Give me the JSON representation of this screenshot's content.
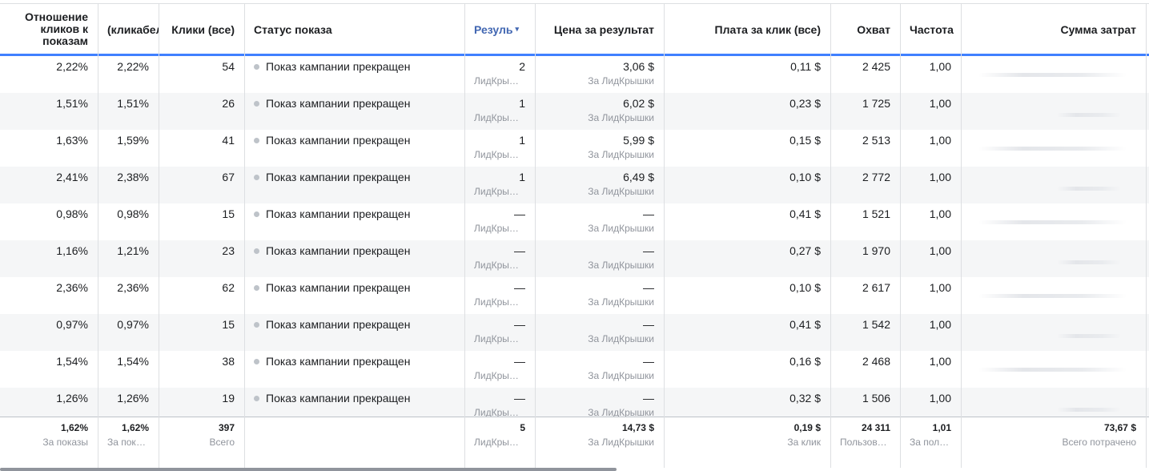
{
  "columns": {
    "ctr": "Отношение кликов к показам",
    "ctr_all": "(кликабельн",
    "clicks_all": "Клики (все)",
    "status": "Статус показа",
    "results": "Резуль",
    "cost_per_result": "Цена за результат",
    "cpc_all": "Плата за клик (все)",
    "reach": "Охват",
    "frequency": "Частота",
    "spend": "Сумма затрат"
  },
  "sort_indicator": "▾",
  "rows": [
    {
      "ctr": "2,22%",
      "ctr_all": "2,22%",
      "clicks": "54",
      "status": "Показ кампании прекращен",
      "results": "2",
      "results_sub": "ЛидКрышки",
      "cost": "3,06 $",
      "cost_sub": "За ЛидКрышки",
      "cpc": "0,11 $",
      "reach": "2 425",
      "freq": "1,00"
    },
    {
      "ctr": "1,51%",
      "ctr_all": "1,51%",
      "clicks": "26",
      "status": "Показ кампании прекращен",
      "results": "1",
      "results_sub": "ЛидКрышки",
      "cost": "6,02 $",
      "cost_sub": "За ЛидКрышки",
      "cpc": "0,23 $",
      "reach": "1 725",
      "freq": "1,00"
    },
    {
      "ctr": "1,63%",
      "ctr_all": "1,59%",
      "clicks": "41",
      "status": "Показ кампании прекращен",
      "results": "1",
      "results_sub": "ЛидКрышки",
      "cost": "5,99 $",
      "cost_sub": "За ЛидКрышки",
      "cpc": "0,15 $",
      "reach": "2 513",
      "freq": "1,00"
    },
    {
      "ctr": "2,41%",
      "ctr_all": "2,38%",
      "clicks": "67",
      "status": "Показ кампании прекращен",
      "results": "1",
      "results_sub": "ЛидКрышки",
      "cost": "6,49 $",
      "cost_sub": "За ЛидКрышки",
      "cpc": "0,10 $",
      "reach": "2 772",
      "freq": "1,00"
    },
    {
      "ctr": "0,98%",
      "ctr_all": "0,98%",
      "clicks": "15",
      "status": "Показ кампании прекращен",
      "results": "—",
      "results_sub": "ЛидКрышки",
      "cost": "—",
      "cost_sub": "За ЛидКрышки",
      "cpc": "0,41 $",
      "reach": "1 521",
      "freq": "1,00"
    },
    {
      "ctr": "1,16%",
      "ctr_all": "1,21%",
      "clicks": "23",
      "status": "Показ кампании прекращен",
      "results": "—",
      "results_sub": "ЛидКрышки",
      "cost": "—",
      "cost_sub": "За ЛидКрышки",
      "cpc": "0,27 $",
      "reach": "1 970",
      "freq": "1,00"
    },
    {
      "ctr": "2,36%",
      "ctr_all": "2,36%",
      "clicks": "62",
      "status": "Показ кампании прекращен",
      "results": "—",
      "results_sub": "ЛидКрышки",
      "cost": "—",
      "cost_sub": "За ЛидКрышки",
      "cpc": "0,10 $",
      "reach": "2 617",
      "freq": "1,00"
    },
    {
      "ctr": "0,97%",
      "ctr_all": "0,97%",
      "clicks": "15",
      "status": "Показ кампании прекращен",
      "results": "—",
      "results_sub": "ЛидКрышки",
      "cost": "—",
      "cost_sub": "За ЛидКрышки",
      "cpc": "0,41 $",
      "reach": "1 542",
      "freq": "1,00"
    },
    {
      "ctr": "1,54%",
      "ctr_all": "1,54%",
      "clicks": "38",
      "status": "Показ кампании прекращен",
      "results": "—",
      "results_sub": "ЛидКрышки",
      "cost": "—",
      "cost_sub": "За ЛидКрышки",
      "cpc": "0,16 $",
      "reach": "2 468",
      "freq": "1,00"
    },
    {
      "ctr": "1,26%",
      "ctr_all": "1,26%",
      "clicks": "19",
      "status": "Показ кампании прекращен",
      "results": "—",
      "results_sub": "ЛидКрышки",
      "cost": "—",
      "cost_sub": "За ЛидКрышки",
      "cpc": "0,32 $",
      "reach": "1 506",
      "freq": "1,00"
    }
  ],
  "totals": {
    "ctr": "1,62%",
    "ctr_sub": "За показы",
    "ctr_all": "1,62%",
    "ctr_all_sub": "За показы",
    "clicks": "397",
    "clicks_sub": "Всего",
    "results": "5",
    "results_sub": "ЛидКрышки",
    "cost": "14,73 $",
    "cost_sub": "За ЛидКрышки",
    "cpc": "0,19 $",
    "cpc_sub": "За клик",
    "reach": "24 311",
    "reach_sub": "Пользователей",
    "freq": "1,01",
    "freq_sub": "За пользователя",
    "spend": "73,67 $",
    "spend_sub": "Всего потрачено"
  }
}
